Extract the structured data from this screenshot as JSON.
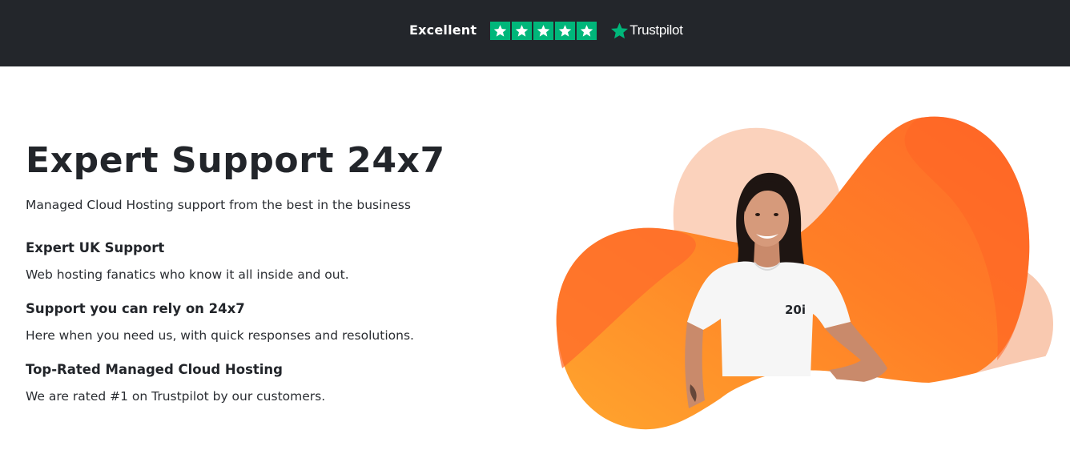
{
  "trustbar": {
    "rating_label": "Excellent",
    "stars": 5,
    "star_color": "#00b67a",
    "logo_icon": "trustpilot-star-icon",
    "logo_text": "Trustpilot"
  },
  "hero": {
    "title": "Expert Support 24x7",
    "subtitle": "Managed Cloud Hosting support from the best in the business",
    "features": [
      {
        "title": "Expert UK Support",
        "text": "Web hosting fanatics who know it all inside and out."
      },
      {
        "title": "Support you can rely on 24x7",
        "text": "Here when you need us, with quick responses and resolutions."
      },
      {
        "title": "Top-Rated Managed Cloud Hosting",
        "text": "We are rated #1 on Trustpilot by our customers."
      }
    ],
    "image": {
      "shirt_logo": "20i",
      "accent_color": "#ff7a1f",
      "blob_light_color": "#f9c9b0"
    }
  },
  "colors": {
    "topbar_bg": "#23262b",
    "text": "#22252a"
  }
}
